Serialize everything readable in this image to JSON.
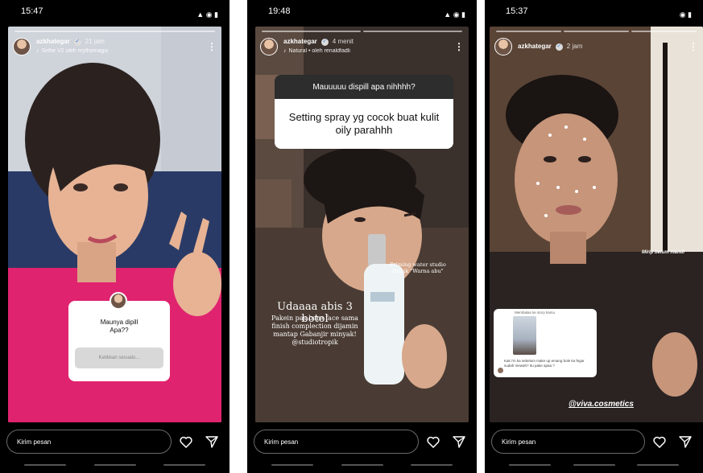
{
  "stories": [
    {
      "status_time": "15:47",
      "username": "azkhategar",
      "time_ago": "21 jam",
      "music": "Selfie V2 oleh mythomagix",
      "question_title": "Maunya dipill\nApa??",
      "question_placeholder": "Ketikkan sesuatu..."
    },
    {
      "status_time": "19:48",
      "username": "azkhategar",
      "time_ago": "4 menit",
      "music": "Natural • oleh renaldfadli",
      "question_head": "Mauuuuu dispill apa nihhhh?",
      "question_answer": "Setting spray yg cocok buat kulit oily parahhh",
      "caption_title": "Udaaaa abis 3 botol",
      "caption_body": "Pakein pas bare face sama finish complection dijamin mantap Gabanjir minyak!\n@studiotropik",
      "caption_product": "Priming water studio tropik \"Warna abu\""
    },
    {
      "status_time": "15:37",
      "username": "azkhategar",
      "time_ago": "2 jam",
      "reply_header": "Membalas ke story kamu",
      "reply_text": "Kak i'm ka sebelum make up emang bole ka fegar sudah mewah? Itu pake apaa ?",
      "tag_mirip": "Mirip belum mandi",
      "tag_viva": "@viva.cosmetics"
    }
  ],
  "bottom": {
    "message_placeholder": "Kirim pesan"
  },
  "colors": {
    "story1_bg": "#e0236f",
    "story2_bg": "#3a302c",
    "story3_bg": "#2a2322"
  }
}
